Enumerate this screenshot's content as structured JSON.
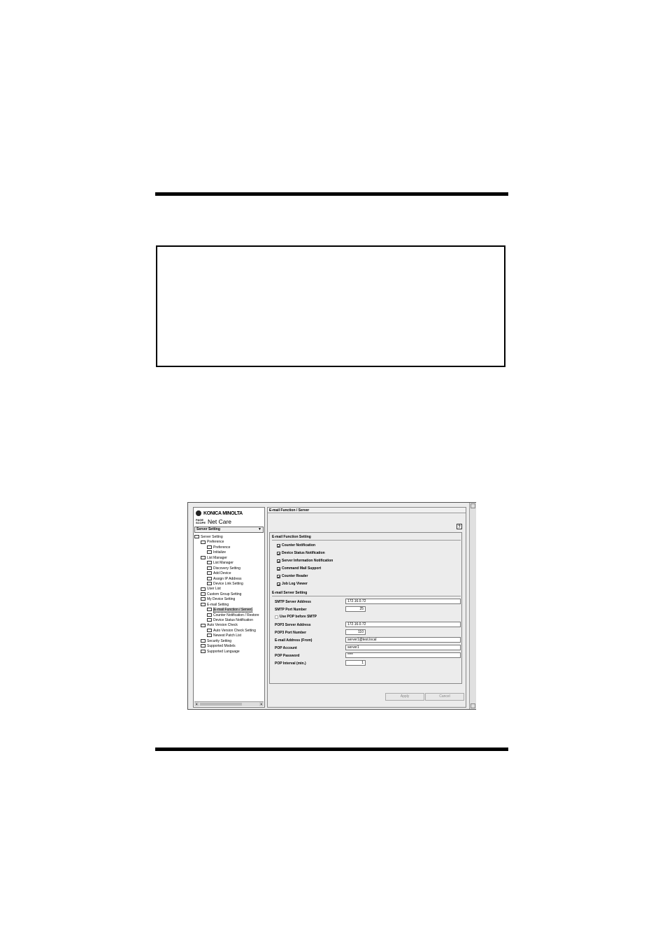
{
  "app": {
    "brand": "KONICA MINOLTA",
    "product_badge": "PAGE SCOPE",
    "product_name": "Net Care"
  },
  "sidebar": {
    "selector_label": "Server Setting",
    "tree": [
      {
        "label": "Server Setting",
        "level": 0
      },
      {
        "label": "Preference",
        "level": 1
      },
      {
        "label": "Preference",
        "level": 2
      },
      {
        "label": "Initialize",
        "level": 2
      },
      {
        "label": "List Manager",
        "level": 1
      },
      {
        "label": "List Manager",
        "level": 2
      },
      {
        "label": "Discovery Setting",
        "level": 2
      },
      {
        "label": "Add Device",
        "level": 2
      },
      {
        "label": "Assign IP Address",
        "level": 2
      },
      {
        "label": "Device Link Setting",
        "level": 2
      },
      {
        "label": "User List",
        "level": 1
      },
      {
        "label": "Custom Group Setting",
        "level": 1
      },
      {
        "label": "My Device Setting",
        "level": 1
      },
      {
        "label": "E-mail Setting",
        "level": 1
      },
      {
        "label": "E-mail Function / Server",
        "level": 2,
        "selected": true
      },
      {
        "label": "Counter Notification / Restore",
        "level": 2
      },
      {
        "label": "Device Status Notification",
        "level": 2
      },
      {
        "label": "Auto Version Check",
        "level": 1
      },
      {
        "label": "Auto Version Check Setting",
        "level": 2
      },
      {
        "label": "Newest Patch List",
        "level": 2
      },
      {
        "label": "Security Setting",
        "level": 1
      },
      {
        "label": "Supported Models",
        "level": 1
      },
      {
        "label": "Supported Language",
        "level": 1
      }
    ]
  },
  "main": {
    "title": "E-mail Function / Server",
    "help_label": "?",
    "function_section": "E-mail Function Setting",
    "checkboxes": [
      {
        "label": "Counter Notification",
        "checked": true
      },
      {
        "label": "Device Status Notification",
        "checked": true
      },
      {
        "label": "Server Information Notification",
        "checked": true
      },
      {
        "label": "Command Mail Support",
        "checked": true
      },
      {
        "label": "Counter Reader",
        "checked": true
      },
      {
        "label": "Job Log Viewer",
        "checked": true
      }
    ],
    "server_section": "E-mail Server Setting",
    "smtp_address_label": "SMTP Server Address",
    "smtp_address_value": "172.16.0.72",
    "smtp_port_label": "SMTP Port Number",
    "smtp_port_value": "25",
    "pop_before_smtp_label": "Use POP before SMTP",
    "pop_before_smtp_checked": false,
    "pop3_address_label": "POP3 Server Address",
    "pop3_address_value": "172.16.0.72",
    "pop3_port_label": "POP3 Port Number",
    "pop3_port_value": "110",
    "email_from_label": "E-mail Address (From)",
    "email_from_value": "server1@test.local",
    "pop_account_label": "POP Account",
    "pop_account_value": "server1",
    "pop_password_label": "POP Password",
    "pop_password_value": "****",
    "pop_interval_label": "POP Interval (min.)",
    "pop_interval_value": "1",
    "apply_label": "Apply",
    "cancel_label": "Cancel"
  }
}
